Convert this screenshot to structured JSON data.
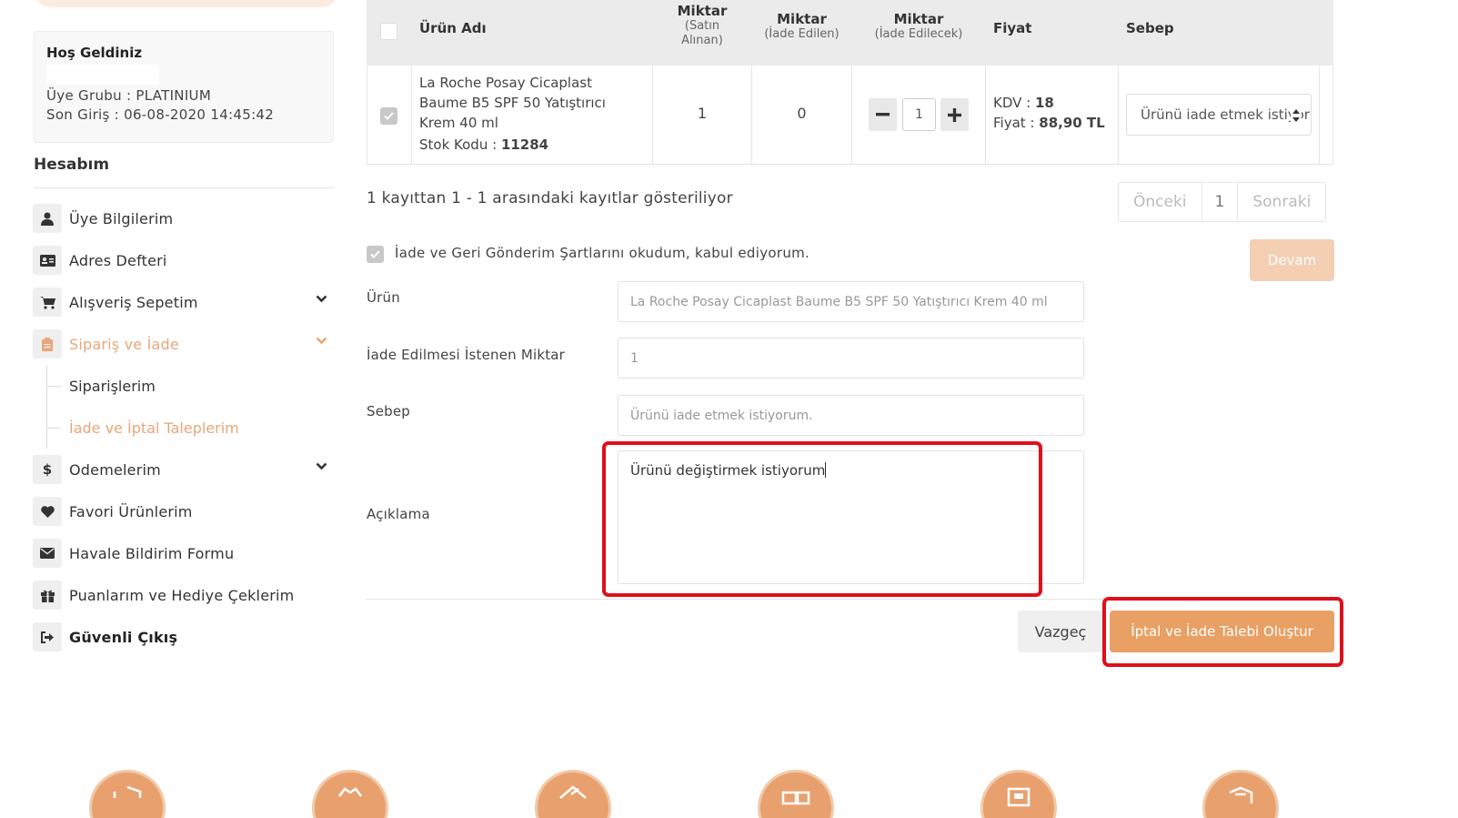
{
  "sidebar": {
    "welcome_title": "Hoş Geldiniz",
    "member_group": "Üye Grubu : PLATINIUM",
    "last_login": "Son Giriş : 06-08-2020 14:45:42",
    "account_title": "Hesabım",
    "items": [
      {
        "label": "Üye Bilgilerim",
        "icon": "user-icon"
      },
      {
        "label": "Adres Defteri",
        "icon": "address-card-icon"
      },
      {
        "label": "Alışveriş Sepetim",
        "icon": "cart-icon"
      },
      {
        "label": "Sipariş ve İade",
        "icon": "clipboard-icon"
      },
      {
        "label": "Siparişlerim"
      },
      {
        "label": "İade ve İptal Taleplerim"
      },
      {
        "label": "Odemelerim",
        "icon": "dollar-icon"
      },
      {
        "label": "Favori Ürünlerim",
        "icon": "heart-icon"
      },
      {
        "label": "Havale Bildirim Formu",
        "icon": "envelope-icon"
      },
      {
        "label": "Puanlarım ve Hediye Çeklerim",
        "icon": "gift-icon"
      },
      {
        "label": "Güvenli Çıkış",
        "icon": "sign-out-icon"
      }
    ]
  },
  "table": {
    "headers": {
      "product": "Ürün Adı",
      "qty_bought": "Miktar",
      "qty_bought_sub": "(Satın Alınan)",
      "qty_returned": "Miktar",
      "qty_returned_sub": "(İade Edilen)",
      "qty_to_return": "Miktar",
      "qty_to_return_sub": "(İade Edilecek)",
      "price": "Fiyat",
      "reason": "Sebep"
    },
    "row": {
      "product_name": "La Roche Posay Cicaplast Baume B5 SPF 50 Yatıştırıcı Krem 40 ml",
      "stock_label": "Stok Kodu :",
      "stock_code": "11284",
      "qty_bought": "1",
      "qty_returned": "0",
      "qty_to_return": "1",
      "kdv_label": "KDV :",
      "kdv": "18",
      "price_label": "Fiyat :",
      "price": "88,90 TL",
      "reason": "Ürünü iade etmek istiyorum."
    }
  },
  "records_info": "1 kayıttan 1 - 1 arasındaki kayıtlar gösteriliyor",
  "pagination": {
    "prev": "Önceki",
    "page": "1",
    "next": "Sonraki"
  },
  "terms_label": "İade ve Geri Gönderim Şartlarını okudum, kabul ediyorum.",
  "continue_button": "Devam",
  "form": {
    "product_label": "Ürün",
    "product_value": "La Roche Posay Cicaplast Baume B5 SPF 50 Yatıştırıcı Krem 40 ml",
    "qty_label": "İade Edilmesi İstenen Miktar",
    "qty_value": "1",
    "reason_label": "Sebep",
    "reason_value": "Ürünü iade etmek istiyorum.",
    "description_label": "Açıklama",
    "description_value": "Ürünü değiştirmek istiyorum"
  },
  "buttons": {
    "cancel": "Vazgeç",
    "submit": "İptal ve İade Talebi Oluştur"
  },
  "colors": {
    "accent": "#e8a064",
    "highlight": "#e0101a",
    "active_menu": "#e8a77a"
  }
}
